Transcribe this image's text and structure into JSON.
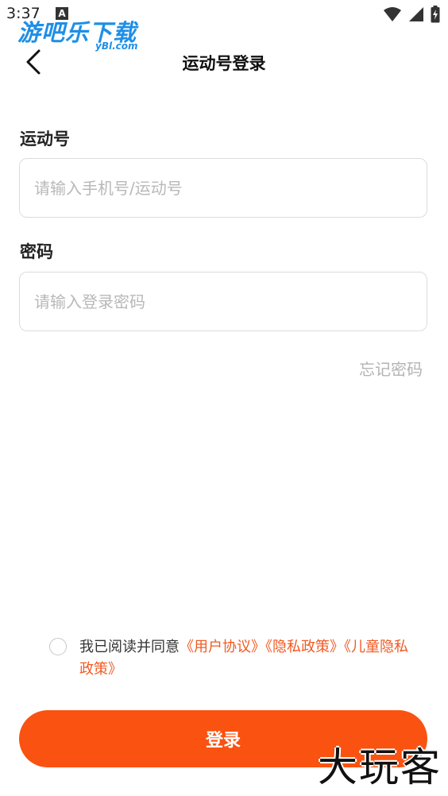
{
  "status_bar": {
    "time": "3:37",
    "notification_icon": "A",
    "icons": [
      "wifi-icon",
      "signal-icon",
      "battery-charging-icon"
    ]
  },
  "watermark_top": {
    "title": "游吧乐下载",
    "subtitle": "yBl.com"
  },
  "header": {
    "back_icon": "chevron-left-icon",
    "title": "运动号登录"
  },
  "form": {
    "account_label": "运动号",
    "account_placeholder": "请输入手机号/运动号",
    "account_value": "",
    "password_label": "密码",
    "password_placeholder": "请输入登录密码",
    "password_value": "",
    "forgot_password": "忘记密码"
  },
  "agreement": {
    "checked": false,
    "prefix": "我已阅读并同意",
    "links": [
      "《用户协议》",
      "《隐私政策》",
      "《儿童隐私政策》"
    ]
  },
  "login_button": "登录",
  "watermark_bottom": "大玩客",
  "colors": {
    "accent": "#fa5210",
    "link": "#f05a22",
    "placeholder": "#b8b8b8",
    "border": "#dcdcdc",
    "watermark_blue": "#1e8fe6"
  }
}
